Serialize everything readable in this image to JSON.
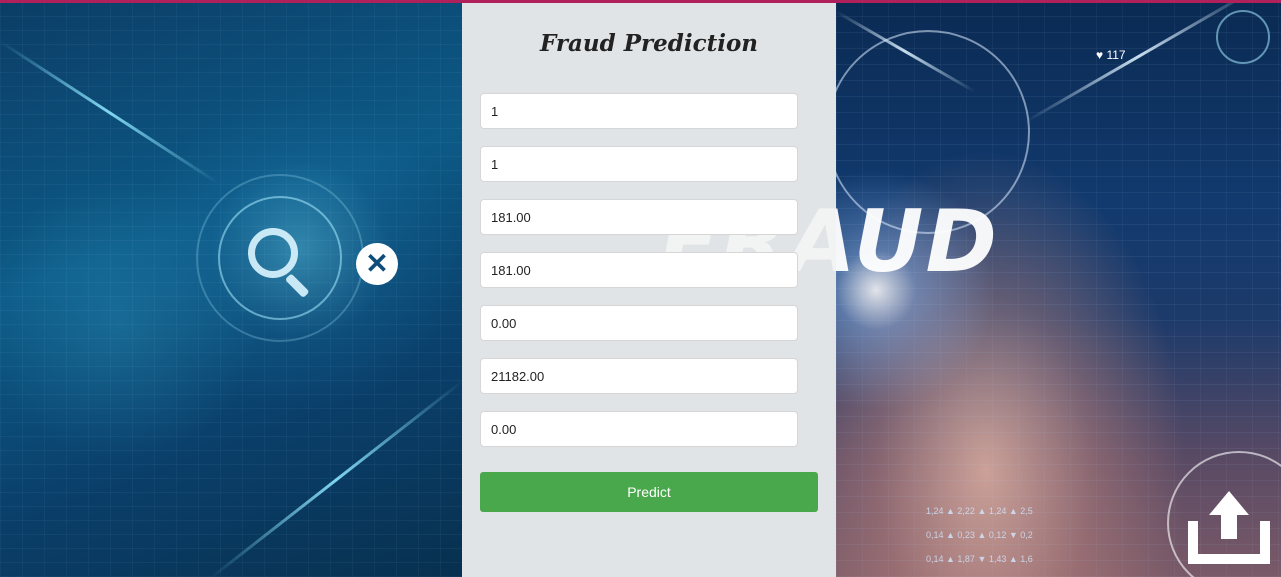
{
  "app": {
    "title": "Fraud Prediction"
  },
  "form": {
    "fields": [
      {
        "value": "1"
      },
      {
        "value": "1"
      },
      {
        "value": "181.00"
      },
      {
        "value": "181.00"
      },
      {
        "value": "0.00"
      },
      {
        "value": "21182.00"
      },
      {
        "value": "0.00"
      }
    ],
    "submit_label": "Predict"
  },
  "background": {
    "headline": "FRAUD",
    "heart_count": "117",
    "ticker": [
      "1,24 ▲ 2,22 ▲ 1,24 ▲ 2,5",
      "0,14 ▲ 0,23 ▲ 0,12 ▼ 0,2",
      "0,14 ▲ 1,87 ▼ 1,43 ▲ 1,6"
    ],
    "icons": [
      "magnifier-icon",
      "close-icon",
      "heart-icon",
      "upload-icon"
    ]
  },
  "colors": {
    "accent_strip": "#b0205a",
    "predict_button": "#4aa84c",
    "panel": "#f2f2f2"
  }
}
